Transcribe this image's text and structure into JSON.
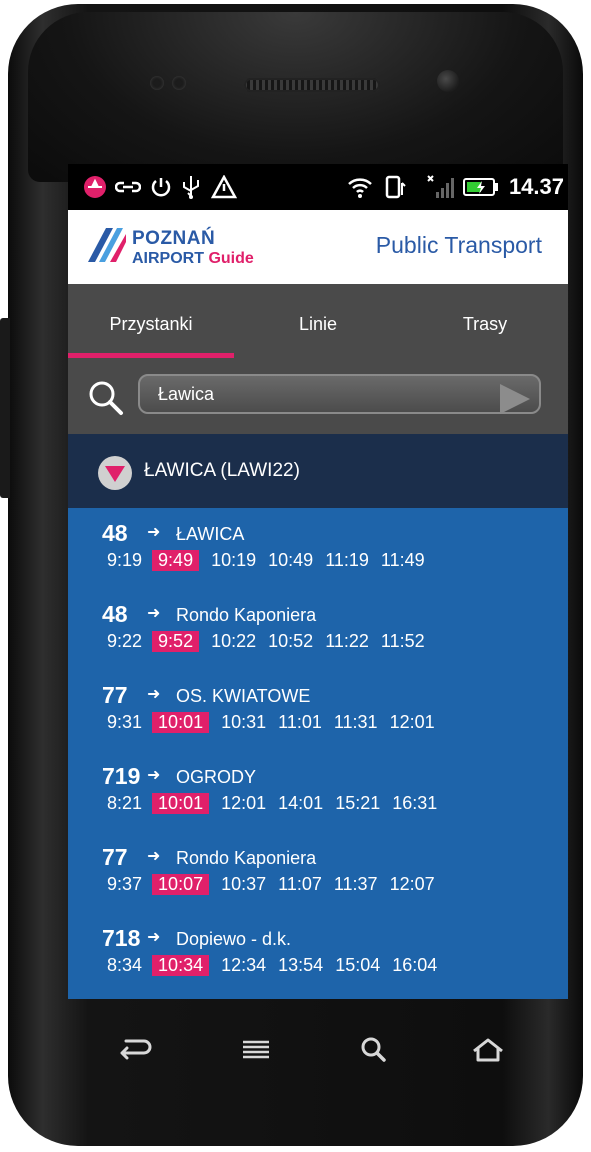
{
  "status_bar": {
    "time": "14.37"
  },
  "header": {
    "logo_line1": "POZNAŃ",
    "logo_line2": "AIRPORT",
    "logo_guide": "Guide",
    "title": "Public Transport"
  },
  "tabs": [
    {
      "label": "Przystanki",
      "active": true
    },
    {
      "label": "Linie",
      "active": false
    },
    {
      "label": "Trasy",
      "active": false
    }
  ],
  "search": {
    "value": "Ławica"
  },
  "stop": {
    "name": "ŁAWICA (LAWI22)"
  },
  "departures": [
    {
      "line": "48",
      "destination": "ŁAWICA",
      "times": [
        "9:19",
        "9:49",
        "10:19",
        "10:49",
        "11:19",
        "11:49"
      ],
      "highlight_index": 1
    },
    {
      "line": "48",
      "destination": "Rondo Kaponiera",
      "times": [
        "9:22",
        "9:52",
        "10:22",
        "10:52",
        "11:22",
        "11:52"
      ],
      "highlight_index": 1
    },
    {
      "line": "77",
      "destination": "OS. KWIATOWE",
      "times": [
        "9:31",
        "10:01",
        "10:31",
        "11:01",
        "11:31",
        "12:01"
      ],
      "highlight_index": 1
    },
    {
      "line": "719",
      "destination": "OGRODY",
      "times": [
        "8:21",
        "10:01",
        "12:01",
        "14:01",
        "15:21",
        "16:31"
      ],
      "highlight_index": 1
    },
    {
      "line": "77",
      "destination": "Rondo Kaponiera",
      "times": [
        "9:37",
        "10:07",
        "10:37",
        "11:07",
        "11:37",
        "12:07"
      ],
      "highlight_index": 1
    },
    {
      "line": "718",
      "destination": "Dopiewo - d.k.",
      "times": [
        "8:34",
        "10:34",
        "12:34",
        "13:54",
        "15:04",
        "16:04"
      ],
      "highlight_index": 1
    }
  ],
  "colors": {
    "accent": "#e0206a",
    "list_bg": "#1e64aa",
    "stop_header_bg": "#1b2e4b",
    "tab_bg": "#4a4a4a"
  }
}
